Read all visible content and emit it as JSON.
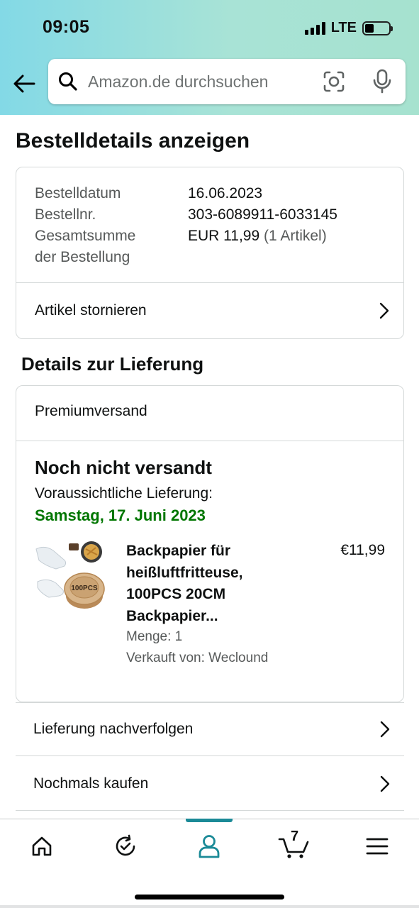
{
  "status_bar": {
    "time": "09:05",
    "network": "LTE"
  },
  "search": {
    "placeholder": "Amazon.de durchsuchen"
  },
  "page": {
    "title": "Bestelldetails anzeigen"
  },
  "order_summary": {
    "rows": [
      {
        "label": "Bestelldatum",
        "value": "16.06.2023"
      },
      {
        "label": "Bestellnr.",
        "value": "303-6089911-6033145"
      },
      {
        "label": "Gesamtsumme",
        "value": "EUR 11,99",
        "extra": "(1 Artikel)"
      },
      {
        "label": "der Bestellung",
        "value": ""
      }
    ],
    "cancel_label": "Artikel stornieren"
  },
  "delivery": {
    "section_title": "Details zur Lieferung",
    "shipping_type": "Premiumversand",
    "status": "Noch nicht versandt",
    "expected_label": "Voraussichtliche Lieferung:",
    "expected_date": "Samstag, 17. Juni 2023",
    "date_color": "#007600",
    "product": {
      "title_lines": [
        "Backpapier für",
        "heißluftfritteuse,",
        "100PCS 20CM",
        "Backpapier..."
      ],
      "price": "€11,99",
      "quantity": "Menge: 1",
      "seller": "Verkauft von: Weclound",
      "image_badge": "100PCS"
    }
  },
  "links": {
    "track": "Lieferung nachverfolgen",
    "buy_again": "Nochmals kaufen"
  },
  "tabbar": {
    "active_tab": "account",
    "accent_color": "#1b8a97",
    "cart_count": "7",
    "tabs": [
      "home-icon",
      "refresh-icon",
      "account-icon",
      "cart-icon",
      "menu-icon"
    ]
  }
}
